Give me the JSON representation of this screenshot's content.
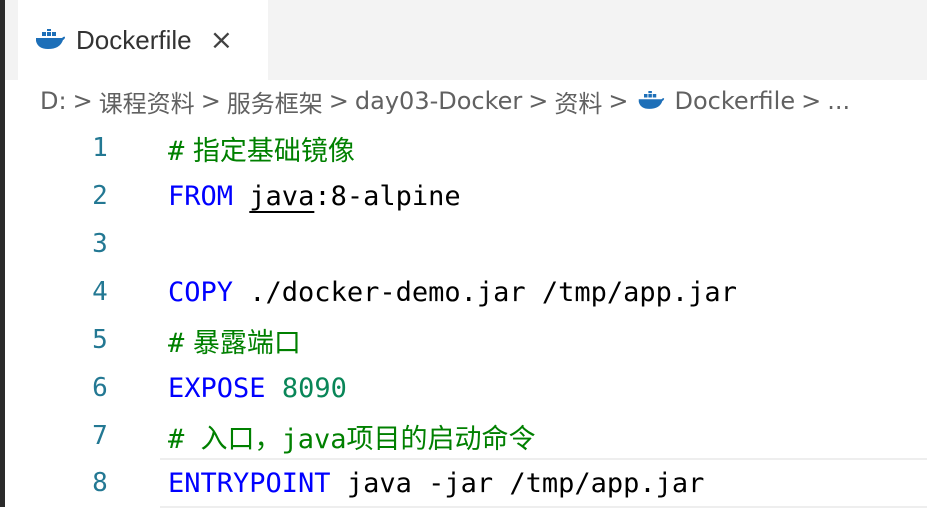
{
  "tab": {
    "label": "Dockerfile",
    "close": "×"
  },
  "breadcrumb": {
    "items": [
      "D:",
      "课程资料",
      "服务框架",
      "day03-Docker",
      "资料",
      "Dockerfile",
      "..."
    ],
    "separator": ">"
  },
  "lines": [
    {
      "num": "1",
      "hash": "#",
      "comment": " 指定基础镜像"
    },
    {
      "num": "2",
      "keyword": "FROM",
      "underlined": "java",
      "rest": ":8-alpine"
    },
    {
      "num": "3"
    },
    {
      "num": "4",
      "keyword": "COPY",
      "rest": " ./docker-demo.jar /tmp/app.jar"
    },
    {
      "num": "5",
      "hash": "#",
      "comment": " 暴露端口"
    },
    {
      "num": "6",
      "keyword": "EXPOSE",
      "number": "8090"
    },
    {
      "num": "7",
      "hash": "#",
      "comment": " 入口，java项目的启动命令"
    },
    {
      "num": "8",
      "keyword": "ENTRYPOINT",
      "rest": " java -jar /tmp/app.jar"
    }
  ],
  "colors": {
    "keyword": "#0000ff",
    "comment": "#008000",
    "number": "#098658",
    "line_number": "#237893",
    "whale_icon": "#1d6fb8"
  }
}
